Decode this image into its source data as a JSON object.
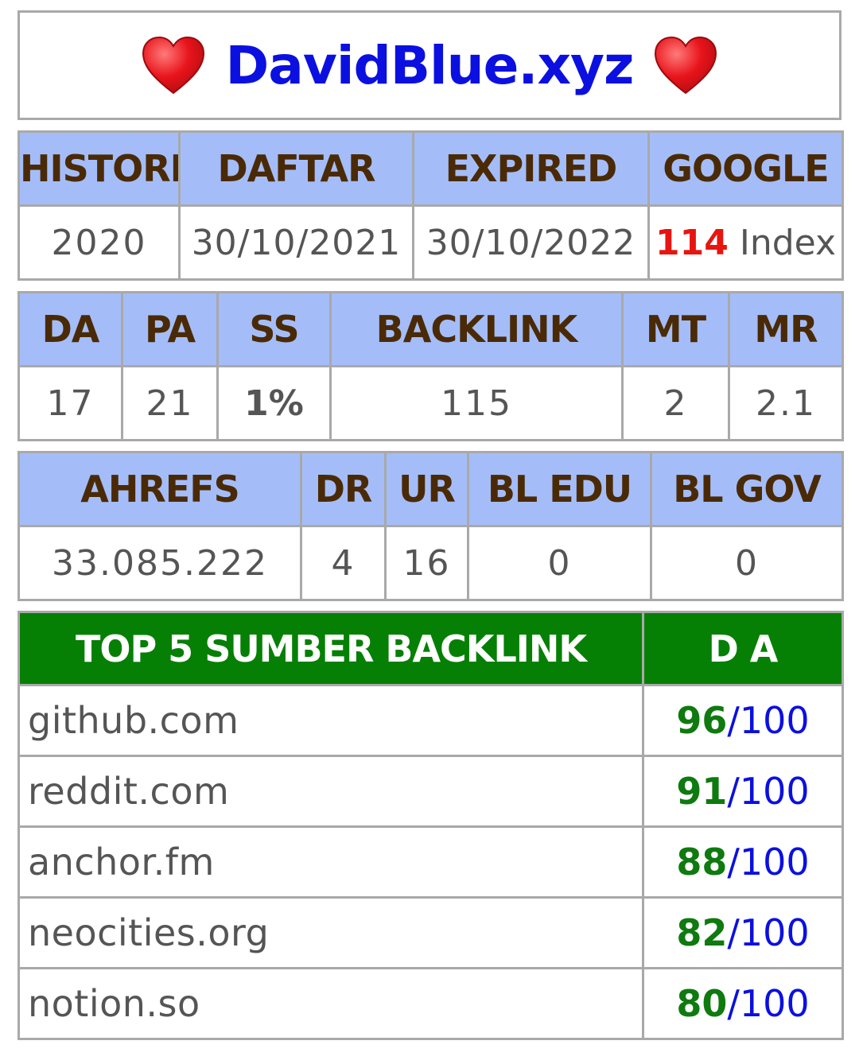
{
  "title": {
    "text": "DavidBlue.xyz",
    "left_icon": "heart-icon",
    "right_icon": "heart-icon",
    "color": "#0b10e0"
  },
  "table1": {
    "headers": [
      "HISTORI",
      "DAFTAR",
      "EXPIRED",
      "GOOGLE"
    ],
    "values": {
      "histori": "2020",
      "daftar": "30/10/2021",
      "expired": "30/10/2022",
      "google_count": "114",
      "google_suffix": "Index"
    }
  },
  "table2": {
    "headers": [
      "DA",
      "PA",
      "SS",
      "BACKLINK",
      "MT",
      "MR"
    ],
    "values": [
      "17",
      "21",
      "1%",
      "115",
      "2",
      "2.1"
    ]
  },
  "table3": {
    "headers": [
      "AHREFS",
      "DR",
      "UR",
      "BL EDU",
      "BL GOV"
    ],
    "values": [
      "33.085.222",
      "4",
      "16",
      "0",
      "0"
    ]
  },
  "top5": {
    "header_source": "TOP 5 SUMBER BACKLINK",
    "header_da": "D A",
    "rows": [
      {
        "site": "github.com",
        "score": "96",
        "max": "/100"
      },
      {
        "site": "reddit.com",
        "score": "91",
        "max": "/100"
      },
      {
        "site": "anchor.fm",
        "score": "88",
        "max": "/100"
      },
      {
        "site": "neocities.org",
        "score": "82",
        "max": "/100"
      },
      {
        "site": "notion.so",
        "score": "80",
        "max": "/100"
      }
    ]
  },
  "colors": {
    "header_bg": "#a4bdf9",
    "header_text": "#4a2a06",
    "top5_header_bg": "#058005",
    "highlight_red": "#e8140f",
    "highlight_green": "#0f7a0f"
  }
}
